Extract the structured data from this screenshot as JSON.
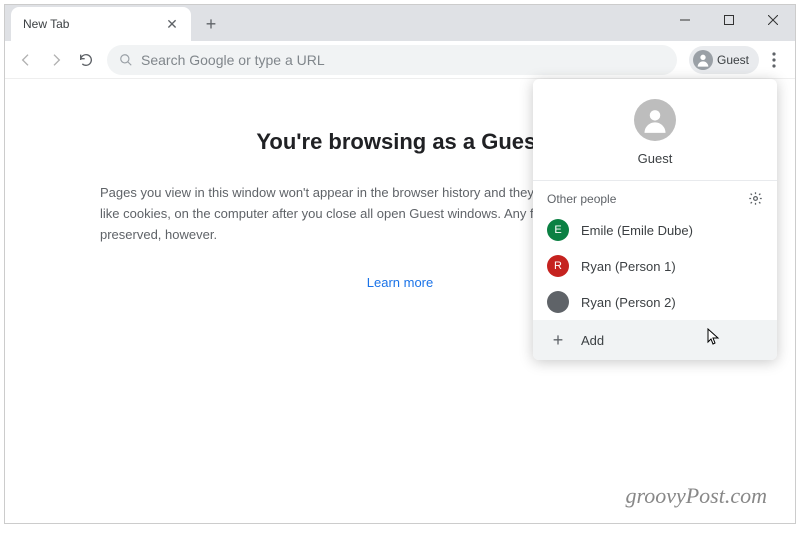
{
  "tab": {
    "title": "New Tab"
  },
  "omnibox": {
    "placeholder": "Search Google or type a URL"
  },
  "profile_chip": {
    "label": "Guest"
  },
  "content": {
    "heading": "You're browsing as a Guest",
    "body": "Pages you view in this window won't appear in the browser history and they won't leave other traces, like cookies, on the computer after you close all open Guest windows. Any files you download will be preserved, however.",
    "learn_more": "Learn more"
  },
  "popup": {
    "current_name": "Guest",
    "section_label": "Other people",
    "people": [
      {
        "label": "Emile (Emile Dube)",
        "initial": "E",
        "color": "#0b8043"
      },
      {
        "label": "Ryan (Person 1)",
        "initial": "R",
        "color": "#c5221f"
      },
      {
        "label": "Ryan (Person 2)",
        "initial": "",
        "color": "#5f6368"
      }
    ],
    "add_label": "Add"
  },
  "watermark": "groovyPost.com"
}
